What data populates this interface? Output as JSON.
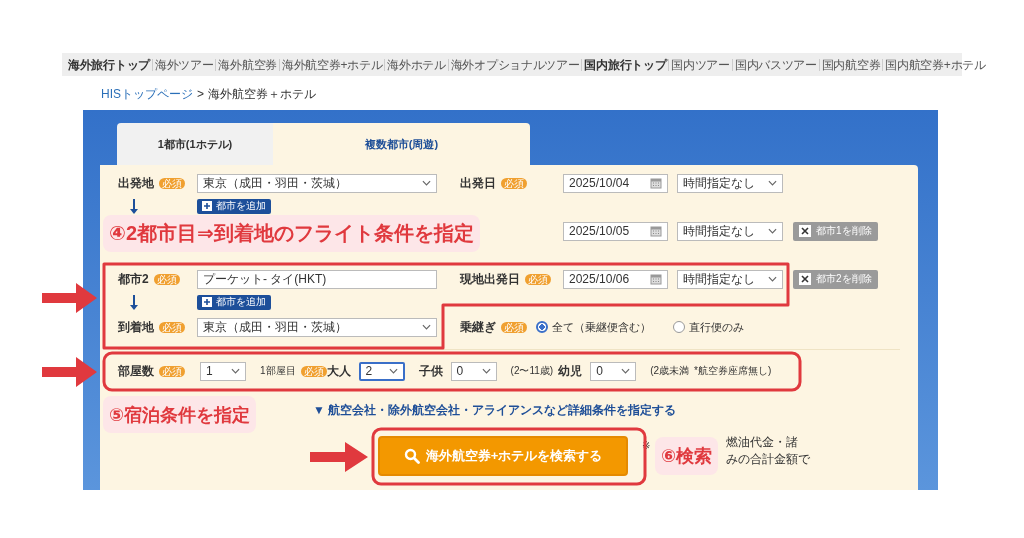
{
  "nav": [
    {
      "label": "海外旅行トップ",
      "kind": "top"
    },
    {
      "label": "海外ツアー",
      "kind": "link"
    },
    {
      "label": "海外航空券",
      "kind": "link"
    },
    {
      "label": "海外航空券+ホテル",
      "kind": "link"
    },
    {
      "label": "海外ホテル",
      "kind": "link"
    },
    {
      "label": "海外オプショナルツアー",
      "kind": "link"
    },
    {
      "label": "国内旅行トップ",
      "kind": "top"
    },
    {
      "label": "国内ツアー",
      "kind": "link"
    },
    {
      "label": "国内バスツアー",
      "kind": "link"
    },
    {
      "label": "国内航空券",
      "kind": "link"
    },
    {
      "label": "国内航空券+ホテル",
      "kind": "link"
    }
  ],
  "breadcrumb": {
    "link": "HISトップページ",
    "separator": ">",
    "current": "海外航空券＋ホテル"
  },
  "tabs": [
    {
      "label": "1都市(1ホテル)",
      "selected": false
    },
    {
      "label": "複数都市(周遊)",
      "selected": true
    }
  ],
  "legs": [
    {
      "label": "出発地",
      "badge": "必須",
      "place": "東京（成田・羽田・茨城）",
      "kind": "select",
      "date_label": "出発日",
      "date_badge": "必須",
      "date": "2025/10/04",
      "time": "時間指定なし",
      "add_button": "都市を追加"
    },
    {
      "date": "2025/10/05",
      "time": "時間指定なし",
      "delete_button": "都市1を削除"
    },
    {
      "label": "都市2",
      "badge": "必須",
      "place": "プーケット- タイ(HKT)",
      "kind": "input",
      "date_label": "現地出発日",
      "date_badge": "必須",
      "date": "2025/10/06",
      "time": "時間指定なし",
      "delete_button": "都市2を削除",
      "add_button": "都市を追加"
    }
  ],
  "arrival": {
    "label": "到着地",
    "badge": "必須",
    "place": "東京（成田・羽田・茨城）"
  },
  "transfer": {
    "label": "乗継ぎ",
    "badge": "必須",
    "options": [
      {
        "label": "全て（乗継便含む）",
        "selected": true
      },
      {
        "label": "直行便のみ",
        "selected": false
      }
    ]
  },
  "rooms": {
    "label": "部屋数",
    "badge": "必須",
    "count": "1",
    "room_label": "1部屋目",
    "room_badge": "必須",
    "guests": [
      {
        "label": "大人",
        "value": "2",
        "focused": true
      },
      {
        "label": "子供",
        "value": "0",
        "focused": false,
        "note": "(2〜11歳)"
      },
      {
        "label": "幼児",
        "value": "0",
        "focused": false,
        "note": "(2歳未満",
        "small_note": "*航空券座席無し)"
      }
    ]
  },
  "details_link": "▼ 航空会社・除外航空会社・アライアンスなど詳細条件を指定する",
  "search_button": "海外航空券+ホテルを検索する",
  "notes": [
    "※",
    "燃油代金・諸",
    "みの合計金額で"
  ],
  "callouts": [
    "④2都市目⇒到着地のフライト条件を指定",
    "⑤宿泊条件を指定",
    "⑥検索"
  ]
}
